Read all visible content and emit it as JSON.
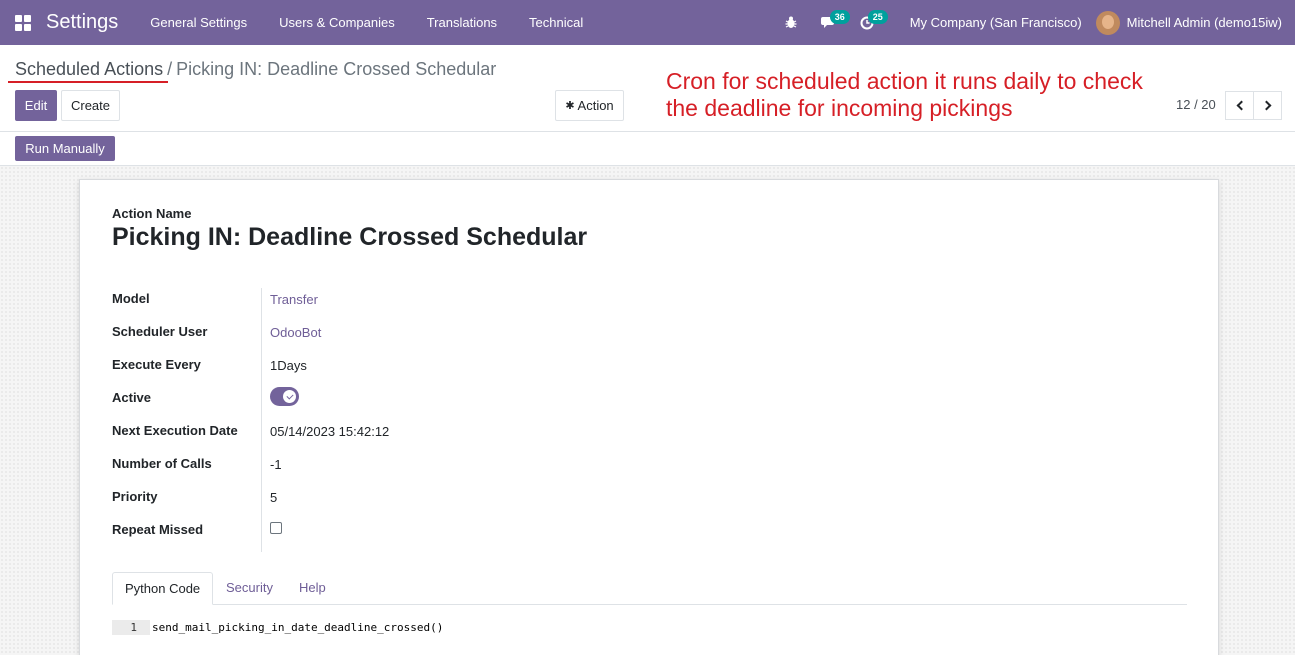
{
  "navbar": {
    "app_title": "Settings",
    "menu": [
      "General Settings",
      "Users & Companies",
      "Translations",
      "Technical"
    ],
    "messages_count": "36",
    "activities_count": "25",
    "company": "My Company (San Francisco)",
    "user": "Mitchell Admin (demo15iw)"
  },
  "breadcrumb": {
    "parent": "Scheduled Actions",
    "separator": "/",
    "current": "Picking IN: Deadline Crossed Schedular"
  },
  "buttons": {
    "edit": "Edit",
    "create": "Create",
    "action": "Action",
    "run_manually": "Run Manually"
  },
  "annotation": "Cron for scheduled action it runs daily to check the deadline for incoming pickings",
  "pager": "12 / 20",
  "form": {
    "name_label": "Action Name",
    "name": "Picking IN: Deadline Crossed Schedular",
    "fields": {
      "model": {
        "label": "Model",
        "value": "Transfer"
      },
      "user": {
        "label": "Scheduler User",
        "value": "OdooBot"
      },
      "interval": {
        "label": "Execute Every",
        "value": "1Days"
      },
      "active": {
        "label": "Active",
        "value": true
      },
      "nextcall": {
        "label": "Next Execution Date",
        "value": "05/14/2023 15:42:12"
      },
      "numbercall": {
        "label": "Number of Calls",
        "value": "-1"
      },
      "priority": {
        "label": "Priority",
        "value": "5"
      },
      "doall": {
        "label": "Repeat Missed",
        "value": false
      }
    }
  },
  "tabs": [
    "Python Code",
    "Security",
    "Help"
  ],
  "code": {
    "line_number": "1",
    "content": "send_mail_picking_in_date_deadline_crossed()"
  },
  "colors": {
    "brand": "#73639b",
    "annotation": "#d61f26",
    "link": "#6f5e97"
  }
}
